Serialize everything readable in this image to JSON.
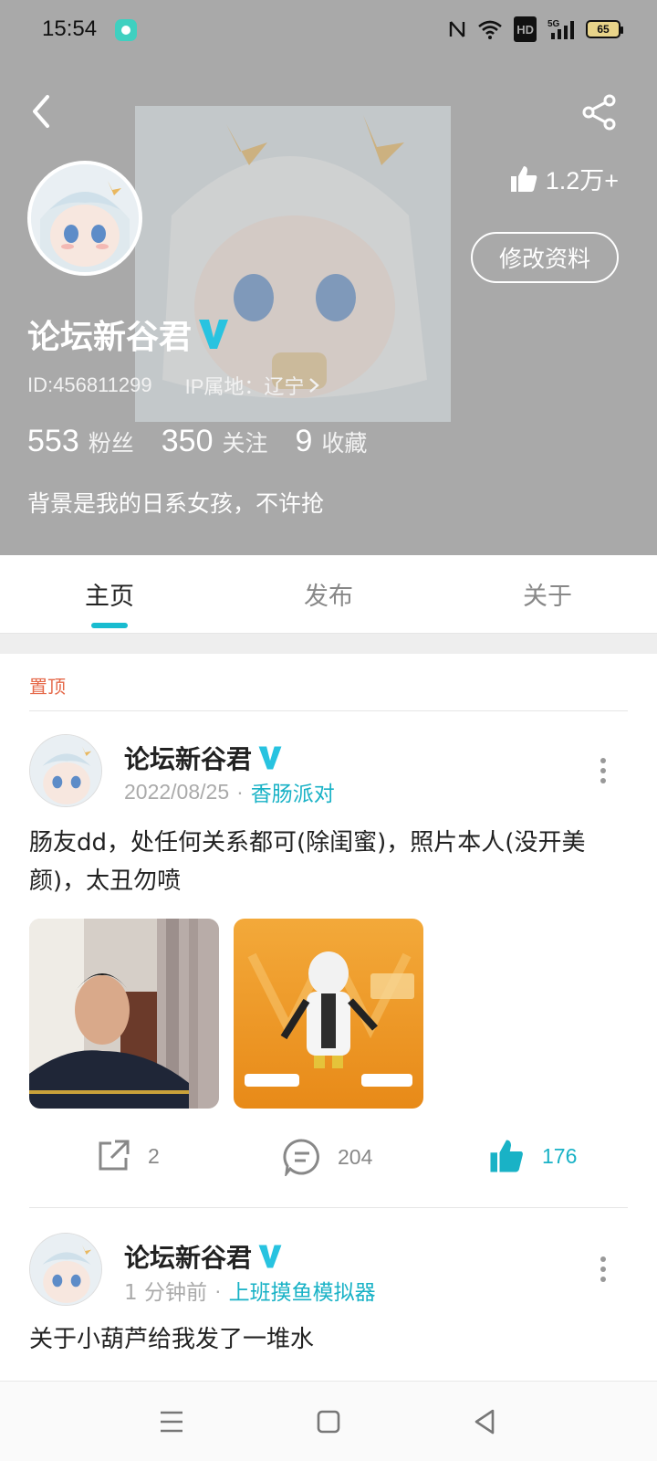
{
  "status_bar": {
    "time": "15:54",
    "network": "5G",
    "hd_label": "HD",
    "battery": "65"
  },
  "header": {
    "likes_total": "1.2万+",
    "edit_profile_label": "修改资料",
    "username": "论坛新谷君",
    "id_text": "ID:456811299",
    "ip_text": "IP属地：辽宁",
    "stats": [
      {
        "num": "553",
        "label": "粉丝"
      },
      {
        "num": "350",
        "label": "关注"
      },
      {
        "num": "9",
        "label": "收藏"
      }
    ],
    "bio": "背景是我的日系女孩，不许抢"
  },
  "tabs": [
    {
      "label": "主页",
      "active": true
    },
    {
      "label": "发布",
      "active": false
    },
    {
      "label": "关于",
      "active": false
    }
  ],
  "feed": {
    "pinned_label": "置顶",
    "posts": [
      {
        "author": "论坛新谷君",
        "date": "2022/08/25",
        "topic": "香肠派对",
        "text": "肠友dd，处任何关系都可(除闺蜜)，照片本人(没开美颜)，太丑勿喷",
        "images": [
          "selfie-photo",
          "game-character-screenshot"
        ],
        "shares": "2",
        "comments": "204",
        "likes": "176"
      },
      {
        "author": "论坛新谷君",
        "date": "1 分钟前",
        "topic": "上班摸鱼模拟器",
        "text": "关于小葫芦给我发了一堆水"
      }
    ]
  },
  "colors": {
    "accent": "#19b2c6",
    "header_bg": "#a9a9a9",
    "pinned": "#e5694a"
  },
  "icons": [
    "back-icon",
    "share-icon",
    "thumbs-up-icon",
    "verified-v-icon",
    "chevron-right-icon",
    "more-vertical-icon",
    "share-out-icon",
    "comment-icon",
    "menu-icon",
    "home-square-icon",
    "back-triangle-icon"
  ]
}
